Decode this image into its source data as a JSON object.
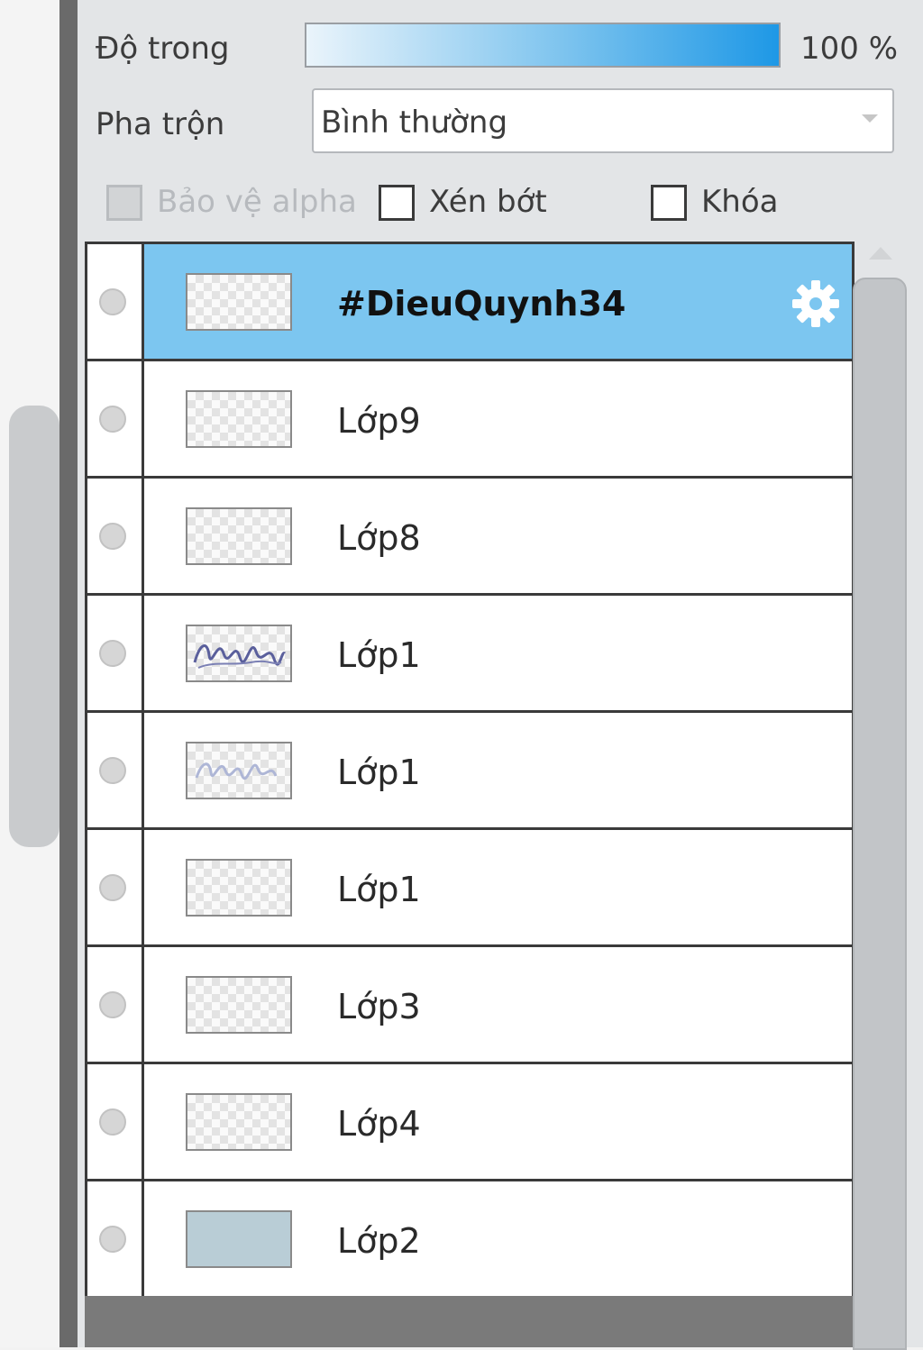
{
  "properties": {
    "opacity_label": "Độ trong",
    "opacity_value": "100 %",
    "opacity_level": 1.0,
    "blend_label": "Pha trộn",
    "blend_value": "Bình thường",
    "protect_alpha_label": "Bảo vệ alpha",
    "clip_label": "Xén bớt",
    "lock_label": "Khóa"
  },
  "layers": [
    {
      "name": "#DieuQuynh34",
      "selected": true,
      "thumb": "checker"
    },
    {
      "name": "Lớp9",
      "selected": false,
      "thumb": "checker"
    },
    {
      "name": "Lớp8",
      "selected": false,
      "thumb": "checker"
    },
    {
      "name": "Lớp1",
      "selected": false,
      "thumb": "handwriting"
    },
    {
      "name": "Lớp1",
      "selected": false,
      "thumb": "handwriting-faint"
    },
    {
      "name": "Lớp1",
      "selected": false,
      "thumb": "checker"
    },
    {
      "name": "Lớp3",
      "selected": false,
      "thumb": "checker"
    },
    {
      "name": "Lớp4",
      "selected": false,
      "thumb": "checker"
    },
    {
      "name": "Lớp2",
      "selected": false,
      "thumb": "solid"
    }
  ],
  "colors": {
    "selected_row": "#7cc6f0",
    "opacity_gradient_end": "#1e98e6",
    "solid_thumb": "#b9cdd6"
  },
  "icons": {
    "visibility": "visibility-dot-icon",
    "settings": "gear-icon",
    "scroll_up": "scroll-up-arrow-icon",
    "dropdown": "dropdown-arrow-icon"
  }
}
